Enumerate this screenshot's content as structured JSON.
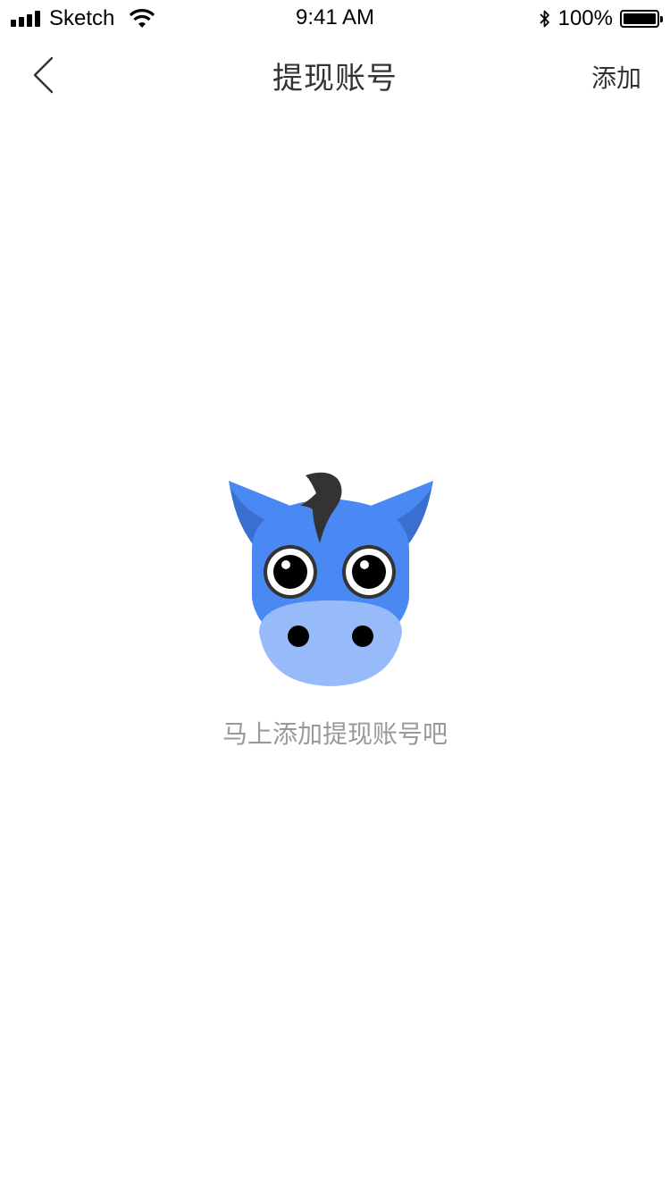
{
  "status_bar": {
    "carrier": "Sketch",
    "time": "9:41 AM",
    "battery_percent": "100%",
    "battery_level": 1.0
  },
  "nav": {
    "title": "提现账号",
    "add_label": "添加",
    "back_icon": "chevron-left-icon"
  },
  "empty_state": {
    "message": "马上添加提现账号吧",
    "illustration": "donkey-mascot",
    "colors": {
      "face": "#4A89F3",
      "ear_inner": "#3A6FD0",
      "muzzle": "#96BBF8",
      "hair": "#333333"
    }
  }
}
